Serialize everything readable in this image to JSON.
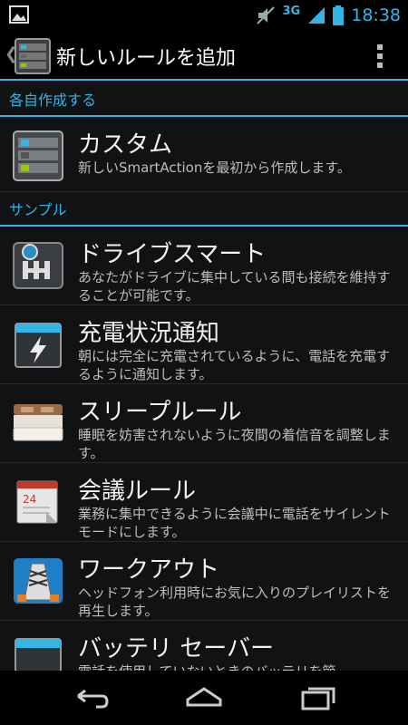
{
  "status_bar": {
    "network": "3G",
    "time": "18:38",
    "icons": [
      "gallery-notification-icon",
      "muted-icon",
      "signal-icon",
      "battery-icon"
    ]
  },
  "action_bar": {
    "title": "新しいルールを追加",
    "icons": [
      "up-chevron-icon",
      "smartactions-app-icon",
      "overflow-menu-icon"
    ]
  },
  "sections": [
    {
      "header": "各自作成する",
      "items": [
        {
          "title": "カスタム",
          "description": "新しいSmartActionを最初から作成します。",
          "icon": "custom-rule-icon"
        }
      ]
    },
    {
      "header": "サンプル",
      "items": [
        {
          "title": "ドライブスマート",
          "description": "あなたがドライブに集中している間も接続を維持することが可能です。",
          "icon": "drive-smart-icon"
        },
        {
          "title": "充電状況通知",
          "description": "朝には完全に充電されているように、電話を充電するように通知します。",
          "icon": "charging-notify-icon"
        },
        {
          "title": "スリープルール",
          "description": "睡眠を妨害されないように夜間の着信音を調整します。",
          "icon": "sleep-rule-icon"
        },
        {
          "title": "会議ルール",
          "description": "業務に集中できるように会議中に電話をサイレント モードにします。",
          "icon": "meeting-rule-icon"
        },
        {
          "title": "ワークアウト",
          "description": "ヘッドフォン利用時にお気に入りのプレイリストを再生します。",
          "icon": "workout-icon"
        },
        {
          "title": "バッテリ セーバー",
          "description": "電話を使用していないときのバッテリを節",
          "icon": "battery-saver-icon"
        }
      ]
    }
  ],
  "nav_bar": {
    "icons": [
      "back-icon",
      "home-icon",
      "recent-apps-icon"
    ]
  },
  "colors": {
    "accent": "#33b5e5",
    "background": "#101214"
  }
}
